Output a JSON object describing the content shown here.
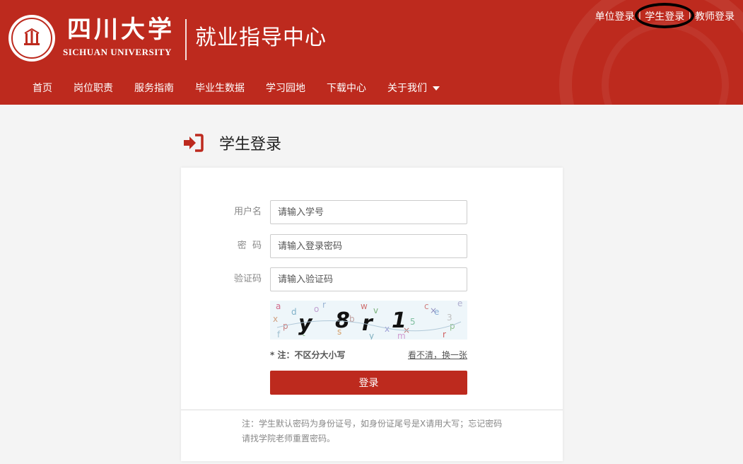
{
  "header": {
    "university_cn": "四川大学",
    "university_en": "SICHUAN UNIVERSITY",
    "site_title": "就业指导中心",
    "brand_color": "#bd2a1e",
    "top_links": [
      {
        "label": "单位登录"
      },
      {
        "label": "学生登录"
      },
      {
        "label": "教师登录"
      }
    ],
    "separator": "|"
  },
  "nav": {
    "items": [
      {
        "label": "首页"
      },
      {
        "label": "岗位职责"
      },
      {
        "label": "服务指南"
      },
      {
        "label": "毕业生数据"
      },
      {
        "label": "学习园地"
      },
      {
        "label": "下载中心"
      },
      {
        "label": "关于我们",
        "has_dropdown": true
      }
    ]
  },
  "page": {
    "title": "学生登录",
    "title_icon": "sign-in-icon"
  },
  "form": {
    "username": {
      "label": "用户名",
      "placeholder": "请输入学号",
      "value": ""
    },
    "password": {
      "label": "密  码",
      "placeholder": "请输入登录密码",
      "value": ""
    },
    "captcha_code": {
      "label": "验证码",
      "placeholder": "请输入验证码",
      "value": ""
    },
    "captcha_note": "* 注：不区分大小写",
    "captcha_refresh": "看不清，换一张",
    "submit_label": "登录"
  },
  "footer_note": "注：学生默认密码为身份证号，如身份证尾号是X请用大写；忘记密码请找学院老师重置密码。"
}
